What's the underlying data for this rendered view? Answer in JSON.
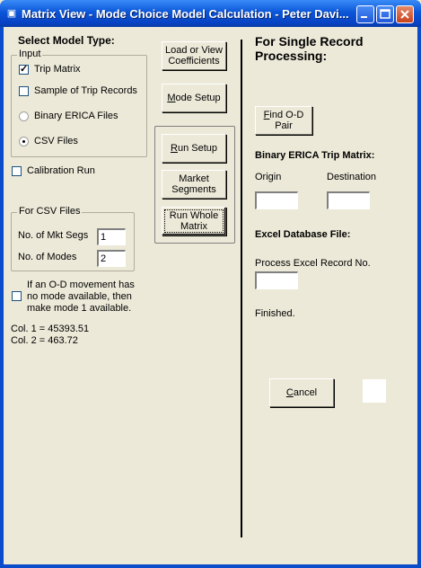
{
  "window": {
    "title": "Matrix View - Mode Choice Model Calculation - Peter Davi..."
  },
  "left": {
    "select_model_type": "Select Model Type:",
    "input_group": "Input",
    "trip_matrix": "Trip Matrix",
    "sample_trip_records": "Sample of Trip Records",
    "binary_erica_files": "Binary ERICA Files",
    "csv_files": "CSV Files",
    "calibration_run": "Calibration Run",
    "csv_group": "For CSV Files",
    "no_mkt_segs_label": "No. of Mkt Segs",
    "no_mkt_segs_value": "1",
    "no_modes_label": "No. of Modes",
    "no_modes_value": "2",
    "od_note": "If an O-D movement has\nno mode available, then\nmake mode 1 available.",
    "col1": "Col. 1 = 45393.51",
    "col2": "Col. 2 = 463.72"
  },
  "buttons": {
    "load_view": "Load or View\nCoefficients",
    "mode_setup_m": "M",
    "mode_setup_rest": "ode Setup",
    "run_setup_r": "R",
    "run_setup_rest": "un Setup",
    "market_segments": "Market\nSegments",
    "run_whole_matrix": "Run Whole\nMatrix",
    "find_od_f": "F",
    "find_od_rest": "ind O-D\nPair",
    "cancel_c": "C",
    "cancel_rest": "ancel"
  },
  "right": {
    "single_record": "For Single Record\nProcessing:",
    "binary_erica_trip_matrix": "Binary ERICA Trip Matrix:",
    "origin": "Origin",
    "destination": "Destination",
    "excel_db_file": "Excel Database File:",
    "process_excel": "Process Excel",
    "record_no": "Record No.",
    "status": "Finished."
  },
  "state": {
    "trip_matrix_checked": true,
    "sample_checked": false,
    "input_mode": "CSV Files",
    "calibration_checked": false,
    "od_note_checked": false
  }
}
